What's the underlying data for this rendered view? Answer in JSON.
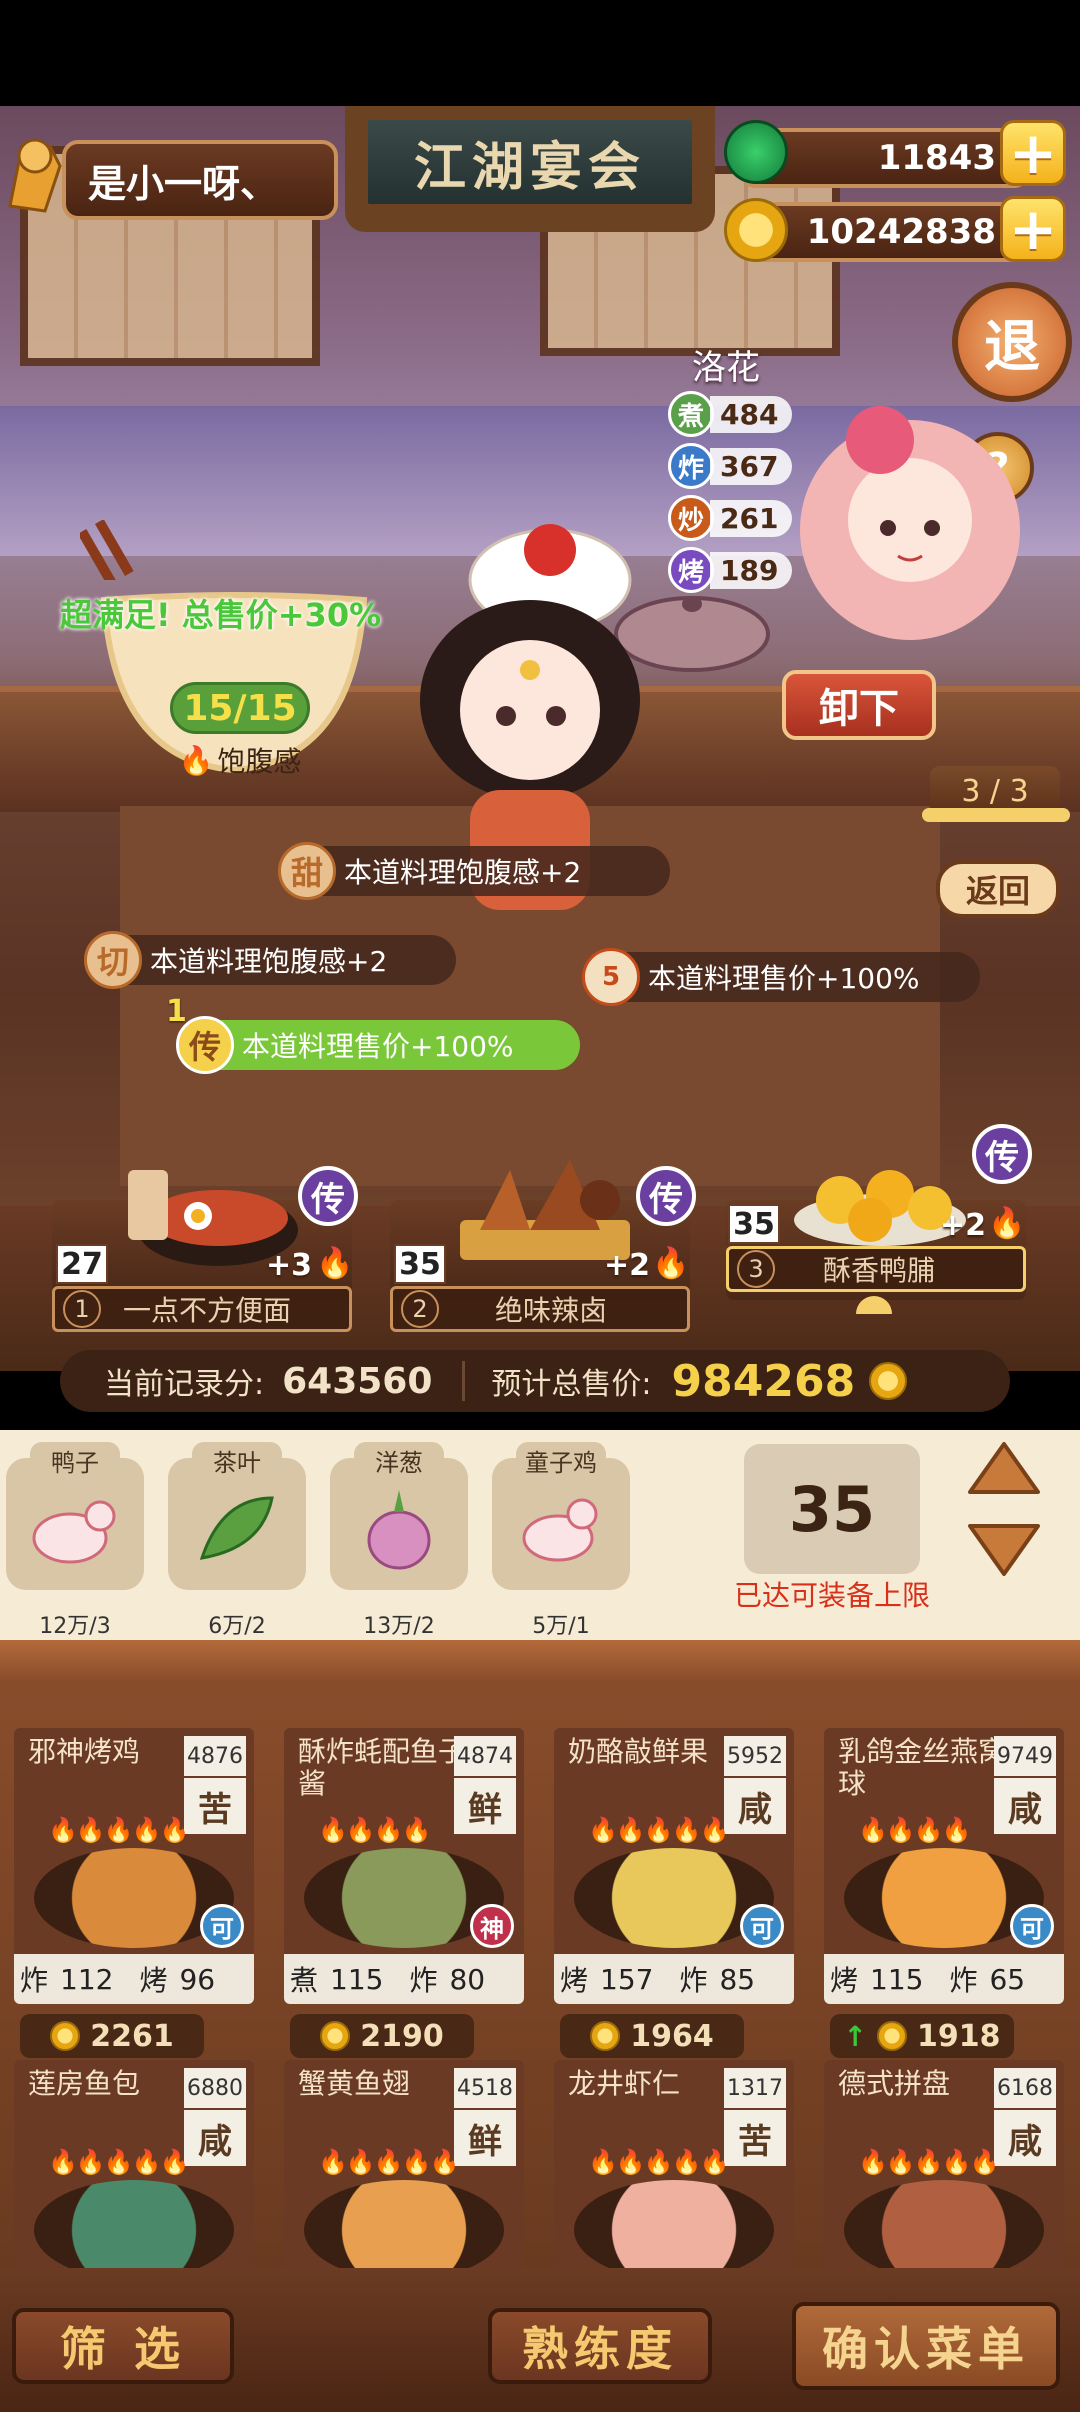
{
  "player": {
    "name": "是小一呀、"
  },
  "title_sign": "江湖宴会",
  "currency": {
    "jade": "11843",
    "coins": "10242838"
  },
  "exit_label": "退",
  "help_label": "?",
  "chef": {
    "name": "洛花",
    "stats": [
      {
        "icon": "煮",
        "value": "484",
        "color": "#5aa04a"
      },
      {
        "icon": "炸",
        "value": "367",
        "color": "#3a7ac8"
      },
      {
        "icon": "炒",
        "value": "261",
        "color": "#c85a1a"
      },
      {
        "icon": "烤",
        "value": "189",
        "color": "#7a4ac0"
      }
    ],
    "unload_label": "卸下"
  },
  "satiety": {
    "bonus": "超满足!  总售价+30%",
    "count": "15/15",
    "label": "饱腹感"
  },
  "page_indicator": "3 / 3",
  "back_label": "返回",
  "buffs": [
    {
      "icon": "甜",
      "text": "本道料理饱腹感+2"
    },
    {
      "icon": "切",
      "text": "本道料理饱腹感+2"
    },
    {
      "icon": "5",
      "text": "本道料理售价+100%"
    },
    {
      "icon": "传",
      "prefix": "1",
      "text": "本道料理售价+100%"
    }
  ],
  "served_dishes": [
    {
      "index": "1",
      "name": "一点不方便面",
      "count": "27",
      "plus": "+3",
      "rarity": "传"
    },
    {
      "index": "2",
      "name": "绝味辣卤",
      "count": "35",
      "plus": "+2",
      "rarity": "传"
    },
    {
      "index": "3",
      "name": "酥香鸭脯",
      "count": "35",
      "plus": "+2",
      "rarity": "传"
    }
  ],
  "score": {
    "record_label": "当前记录分:",
    "record_value": "643560",
    "total_label": "预计总售价:",
    "total_value": "984268"
  },
  "ingredients": [
    {
      "name": "鸭子",
      "qty": "12万/3"
    },
    {
      "name": "茶叶",
      "qty": "6万/2"
    },
    {
      "name": "洋葱",
      "qty": "13万/2"
    },
    {
      "name": "童子鸡",
      "qty": "5万/1"
    }
  ],
  "quantity": {
    "value": "35",
    "notice": "已达可装备上限"
  },
  "menu": [
    {
      "name": "邪神烤鸡",
      "score": "4876",
      "flavor": "苦",
      "flames": "🔥🔥🔥🔥🔥",
      "tech": [
        [
          "炸",
          "112"
        ],
        [
          "烤",
          "96"
        ]
      ],
      "badge": "可",
      "badge_color": "#3a8ac8",
      "price": "2261",
      "food_color": "#d98a3a"
    },
    {
      "name": "酥炸蚝配鱼子酱",
      "score": "4874",
      "flavor": "鲜",
      "flames": "🔥🔥🔥🔥",
      "tech": [
        [
          "煮",
          "115"
        ],
        [
          "炸",
          "80"
        ]
      ],
      "badge": "神",
      "badge_color": "#c0304a",
      "price": "2190",
      "food_color": "#8a9a5a"
    },
    {
      "name": "奶酪敲鲜果",
      "score": "5952",
      "flavor": "咸",
      "flames": "🔥🔥🔥🔥🔥",
      "tech": [
        [
          "烤",
          "157"
        ],
        [
          "炸",
          "85"
        ]
      ],
      "badge": "可",
      "badge_color": "#3a8ac8",
      "price": "1964",
      "food_color": "#e8c85a"
    },
    {
      "name": "乳鸽金丝燕窝球",
      "score": "9749",
      "flavor": "咸",
      "flames": "🔥🔥🔥🔥",
      "tech": [
        [
          "烤",
          "115"
        ],
        [
          "炸",
          "65"
        ]
      ],
      "badge": "可",
      "badge_color": "#3a8ac8",
      "price": "1918",
      "food_color": "#f0a040",
      "price_up": true
    },
    {
      "name": "莲房鱼包",
      "score": "6880",
      "flavor": "咸",
      "flames": "🔥🔥🔥🔥🔥",
      "tech": [],
      "badge": "",
      "badge_color": "#3a8a4a",
      "price": "",
      "food_color": "#4a8a6a"
    },
    {
      "name": "蟹黄鱼翅",
      "score": "4518",
      "flavor": "鲜",
      "flames": "🔥🔥🔥🔥🔥",
      "tech": [],
      "badge": "",
      "badge_color": "#c0304a",
      "price": "",
      "food_color": "#e8a050"
    },
    {
      "name": "龙井虾仁",
      "score": "1317",
      "flavor": "苦",
      "flames": "🔥🔥🔥🔥🔥",
      "tech": [],
      "badge": "",
      "badge_color": "#3a8ac8",
      "price": "",
      "food_color": "#f0b0a0"
    },
    {
      "name": "德式拼盘",
      "score": "6168",
      "flavor": "咸",
      "flames": "🔥🔥🔥🔥🔥",
      "tech": [],
      "badge": "",
      "badge_color": "#3a8ac8",
      "price": "",
      "food_color": "#b06040"
    }
  ],
  "bottom": {
    "filter": "筛 选",
    "proficiency": "熟练度",
    "confirm": "确认菜单"
  }
}
